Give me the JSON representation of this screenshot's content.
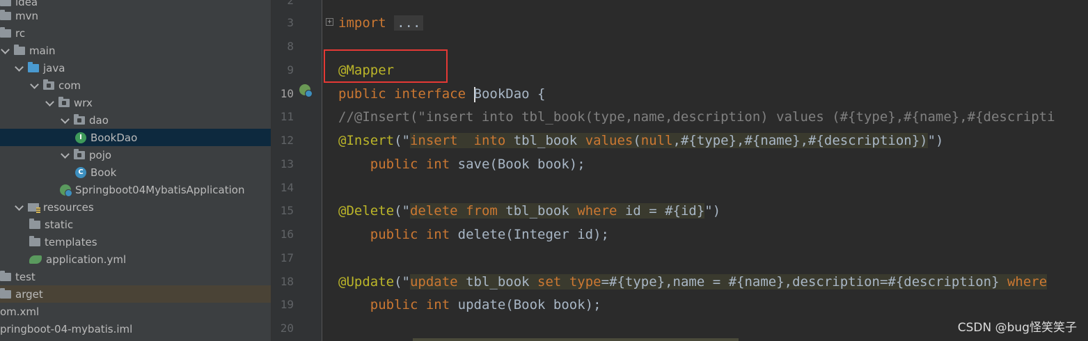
{
  "project_tree": [
    {
      "label": "idea",
      "icon": "folder-icon",
      "indent": 0
    },
    {
      "label": "mvn",
      "icon": "folder-icon",
      "indent": 0
    },
    {
      "label": "rc",
      "icon": "folder-icon",
      "indent": 0
    },
    {
      "label": "main",
      "icon": "folder-icon",
      "indent": 0
    },
    {
      "label": "java",
      "icon": "source-folder-icon",
      "indent": 1
    },
    {
      "label": "com",
      "icon": "package-icon",
      "indent": 2
    },
    {
      "label": "wrx",
      "icon": "package-icon",
      "indent": 3
    },
    {
      "label": "dao",
      "icon": "package-icon",
      "indent": 4
    },
    {
      "label": "BookDao",
      "icon": "interface-icon",
      "indent": 5,
      "selected": true
    },
    {
      "label": "pojo",
      "icon": "package-icon",
      "indent": 4
    },
    {
      "label": "Book",
      "icon": "class-icon",
      "indent": 5
    },
    {
      "label": "Springboot04MybatisApplication",
      "icon": "spring-boot-class-icon",
      "indent": 4
    },
    {
      "label": "resources",
      "icon": "resources-folder-icon",
      "indent": 1
    },
    {
      "label": "static",
      "icon": "folder-icon",
      "indent": 2
    },
    {
      "label": "templates",
      "icon": "folder-icon",
      "indent": 2
    },
    {
      "label": "application.yml",
      "icon": "yaml-file-icon",
      "indent": 2
    },
    {
      "label": "test",
      "icon": "folder-icon",
      "indent": 0
    },
    {
      "label": "arget",
      "icon": "folder-icon",
      "indent": 0
    },
    {
      "label": "om.xml",
      "icon": "xml-file-icon",
      "indent": 0
    },
    {
      "label": "pringboot-04-mybatis.iml",
      "icon": "iml-file-icon",
      "indent": 0
    }
  ],
  "editor": {
    "line_numbers": [
      "2",
      "3",
      "8",
      "9",
      "10",
      "11",
      "12",
      "13",
      "14",
      "15",
      "16",
      "17",
      "18",
      "19",
      "20"
    ],
    "current_line": "10",
    "lines": {
      "l3_import": "import",
      "l3_fold": "...",
      "l9_ann": "@Mapper",
      "l10_public": "public",
      "l10_interface": "interface",
      "l10_name": "BookDao",
      "l10_brace": " {",
      "l11_comment": "//@Insert(\"insert into tbl_book(type,name,description) values (#{type},#{name},#{descripti",
      "l12_ann": "@Insert",
      "l12_open": "(\"",
      "l12_insert": "insert",
      "l12_into": "into",
      "l12_table": "tbl_book",
      "l12_values": "values",
      "l12_args_open": "(",
      "l12_null": "null",
      "l12_rest": ",#{type},#{name},#{description})",
      "l12_close": "\")",
      "l13_public": "public",
      "l13_int": "int",
      "l13_rest": "save(Book book);",
      "l15_ann": "@Delete",
      "l15_open": "(\"",
      "l15_delete": "delete",
      "l15_from": "from",
      "l15_table": "tbl_book",
      "l15_where": "where",
      "l15_rest": "id = #{id}",
      "l15_close": "\")",
      "l16_public": "public",
      "l16_int": "int",
      "l16_rest": "delete(Integer id);",
      "l18_ann": "@Update",
      "l18_open": "(\"",
      "l18_update": "update",
      "l18_table": "tbl_book",
      "l18_set": "set",
      "l18_type": "type",
      "l18_rest": "=#{type},name = #{name},description=#{description}",
      "l18_where": "where",
      "l19_public": "public",
      "l19_int": "int",
      "l19_rest": "update(Book book);"
    }
  },
  "watermark": "CSDN @bug怪笑笑子",
  "colors": {
    "highlight_box": "#e53935",
    "keyword": "#cc7832",
    "annotation": "#bbb529",
    "comment": "#808080"
  }
}
